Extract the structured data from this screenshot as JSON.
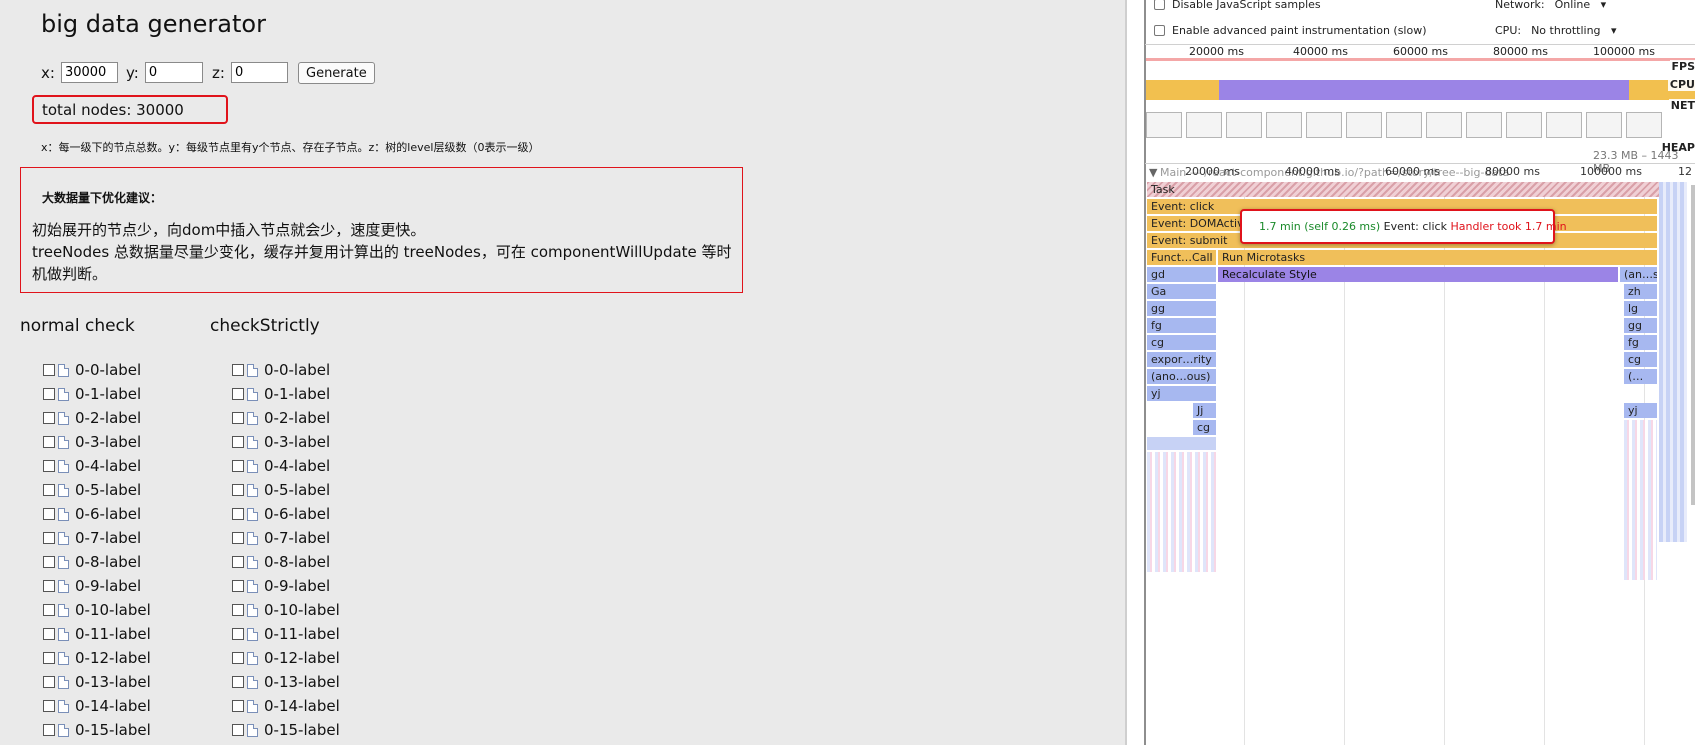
{
  "app": {
    "title": "big data generator",
    "controls": {
      "x_label": "x:",
      "x_value": "30000",
      "y_label": "y:",
      "y_value": "0",
      "z_label": "z:",
      "z_value": "0",
      "generate_label": "Generate"
    },
    "total": "total nodes: 30000",
    "description": "x：每一级下的节点总数。y：每级节点里有y个节点、存在子节点。z：树的level层级数（0表示一级）",
    "tips": {
      "title": "大数据量下优化建议：",
      "line1": "初始展开的节点少，向dom中插入节点就会少，速度更快。",
      "line2": "treeNodes 总数据量尽量少变化，缓存并复用计算出的 treeNodes，可在 componentWillUpdate 等时机做判断。"
    },
    "tree_normal_header": "normal check",
    "tree_strict_header": "checkStrictly",
    "tree_items": [
      "0-0-label",
      "0-1-label",
      "0-2-label",
      "0-3-label",
      "0-4-label",
      "0-5-label",
      "0-6-label",
      "0-7-label",
      "0-8-label",
      "0-9-label",
      "0-10-label",
      "0-11-label",
      "0-12-label",
      "0-13-label",
      "0-14-label",
      "0-15-label"
    ]
  },
  "devtools": {
    "disable_js_samples": "Disable JavaScript samples",
    "enable_paint": "Enable advanced paint instrumentation (slow)",
    "network_label": "Network:",
    "network_value": "Online",
    "cpu_label": "CPU:",
    "cpu_value": "No throttling",
    "ticks": [
      "20000 ms",
      "40000 ms",
      "60000 ms",
      "80000 ms",
      "100000 ms"
    ],
    "tick_extra": "12",
    "tracks": {
      "fps": "FPS",
      "cpu": "CPU",
      "net": "NET",
      "heap": "HEAP"
    },
    "heap_range": "23.3 MB – 1443 MB",
    "main_label": "Main — /react-component.github.io/?path=/story/tree--big-data",
    "flame": {
      "task": "Task",
      "click": "Event: click",
      "domactivate": "Event: DOMActivate",
      "submit": "Event: submit",
      "funct_call": "Funct…Call",
      "run_microtasks": "Run Microtasks",
      "gd": "gd",
      "recalc": "Recalculate Style",
      "ans": "(an…s)",
      "ga": "Ga",
      "zh": "zh",
      "gg": "gg",
      "lg": "lg",
      "fg": "fg",
      "gg2": "gg",
      "cg": "cg",
      "fg2": "fg",
      "expor": "expor…rity",
      "cg2": "cg",
      "anon": "(ano…ous)",
      "paren": "(…",
      "yj": "yj",
      "yj2": "yj",
      "jj": "Jj",
      "cg3": "cg"
    },
    "tooltip": {
      "time": "1.7 min (self 0.26 ms)",
      "event": "Event: click",
      "warning": "Handler took 1.7 min"
    }
  }
}
